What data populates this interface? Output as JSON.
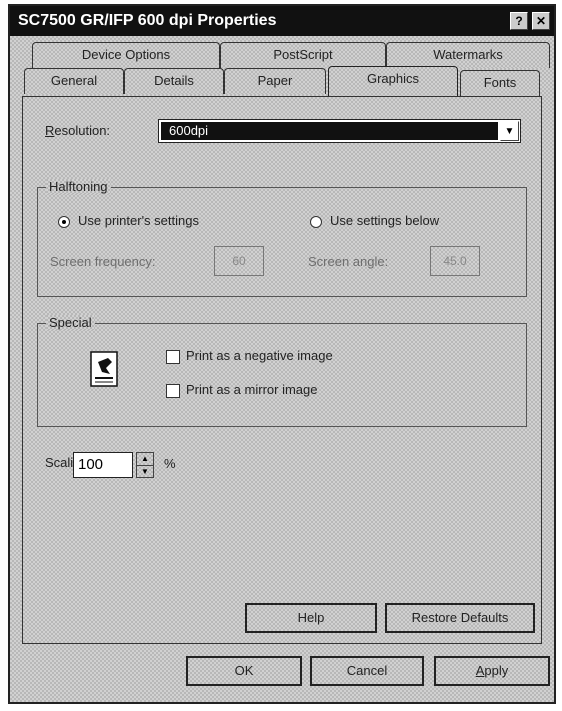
{
  "window": {
    "title": "SC7500 GR/IFP 600 dpi Properties",
    "help_glyph": "?",
    "close_glyph": "✕"
  },
  "tabs_back": [
    {
      "label": "Device Options"
    },
    {
      "label": "PostScript"
    },
    {
      "label": "Watermarks"
    }
  ],
  "tabs_front": [
    {
      "label": "General"
    },
    {
      "label": "Details"
    },
    {
      "label": "Paper"
    },
    {
      "label": "Graphics"
    },
    {
      "label": "Fonts"
    }
  ],
  "active_tab": "Graphics",
  "resolution": {
    "label": "Resolution:",
    "value": "600dpi",
    "arrow_glyph": "▼"
  },
  "halftoning": {
    "title": "Halftoning",
    "option_printer": "Use printer's settings",
    "option_below": "Use settings below",
    "selected": "option_printer",
    "screen_frequency_label": "Screen frequency:",
    "screen_frequency_value": "60",
    "screen_angle_label": "Screen angle:",
    "screen_angle_value": "45.0"
  },
  "special": {
    "title": "Special",
    "negative_label": "Print as a negative image",
    "mirror_label": "Print as a mirror image",
    "negative_checked": false,
    "mirror_checked": false
  },
  "scaling": {
    "label": "Scaling:",
    "value": "100",
    "unit": "%"
  },
  "buttons": {
    "help": "Help",
    "restore": "Restore Defaults",
    "ok": "OK",
    "cancel": "Cancel",
    "apply": "Apply"
  },
  "icons": {
    "document": "document-printer-icon",
    "spin_up": "▲",
    "spin_down": "▼"
  }
}
